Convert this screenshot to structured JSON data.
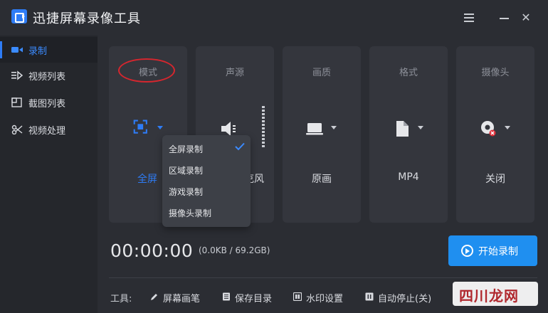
{
  "titlebar": {
    "title": "迅捷屏幕录像工具",
    "close_glyph": "✕"
  },
  "sidebar": {
    "items": [
      {
        "label": "录制",
        "icon": "video-camera-icon",
        "active": true
      },
      {
        "label": "视频列表",
        "icon": "video-list-icon",
        "active": false
      },
      {
        "label": "截图列表",
        "icon": "screenshot-list-icon",
        "active": false
      },
      {
        "label": "视频处理",
        "icon": "video-process-icon",
        "active": false
      }
    ]
  },
  "cards": {
    "mode": {
      "title": "模式",
      "value": "全屏",
      "icon": "fullscreen-icon"
    },
    "audio": {
      "title": "声源",
      "value": "麦克风",
      "icon": "speaker-icon"
    },
    "quality": {
      "title": "画质",
      "value": "原画",
      "icon": "monitor-icon"
    },
    "format": {
      "title": "格式",
      "value": "MP4",
      "icon": "file-icon"
    },
    "camera": {
      "title": "摄像头",
      "value": "关闭",
      "icon": "webcam-icon"
    }
  },
  "mode_dropdown": {
    "options": [
      {
        "label": "全屏录制",
        "selected": true
      },
      {
        "label": "区域录制",
        "selected": false
      },
      {
        "label": "游戏录制",
        "selected": false
      },
      {
        "label": "摄像头录制",
        "selected": false
      }
    ]
  },
  "recording": {
    "timer": "00:00:00",
    "file_size": "(0.0KB / 69.2GB)",
    "start_label": "开始录制"
  },
  "toolbar": {
    "label": "工具:",
    "tools": [
      {
        "label": "屏幕画笔",
        "icon": "pen-icon"
      },
      {
        "label": "保存目录",
        "icon": "folder-icon"
      },
      {
        "label": "水印设置",
        "icon": "watermark-icon"
      },
      {
        "label": "自动停止(关)",
        "icon": "auto-stop-icon"
      }
    ]
  },
  "watermark": {
    "text": "四川龙网"
  },
  "colors": {
    "accent": "#2e7cf6",
    "start_button": "#1f8ff0",
    "highlight_ring": "#d6262e",
    "background": "#2b2d33",
    "card": "#34363d"
  }
}
